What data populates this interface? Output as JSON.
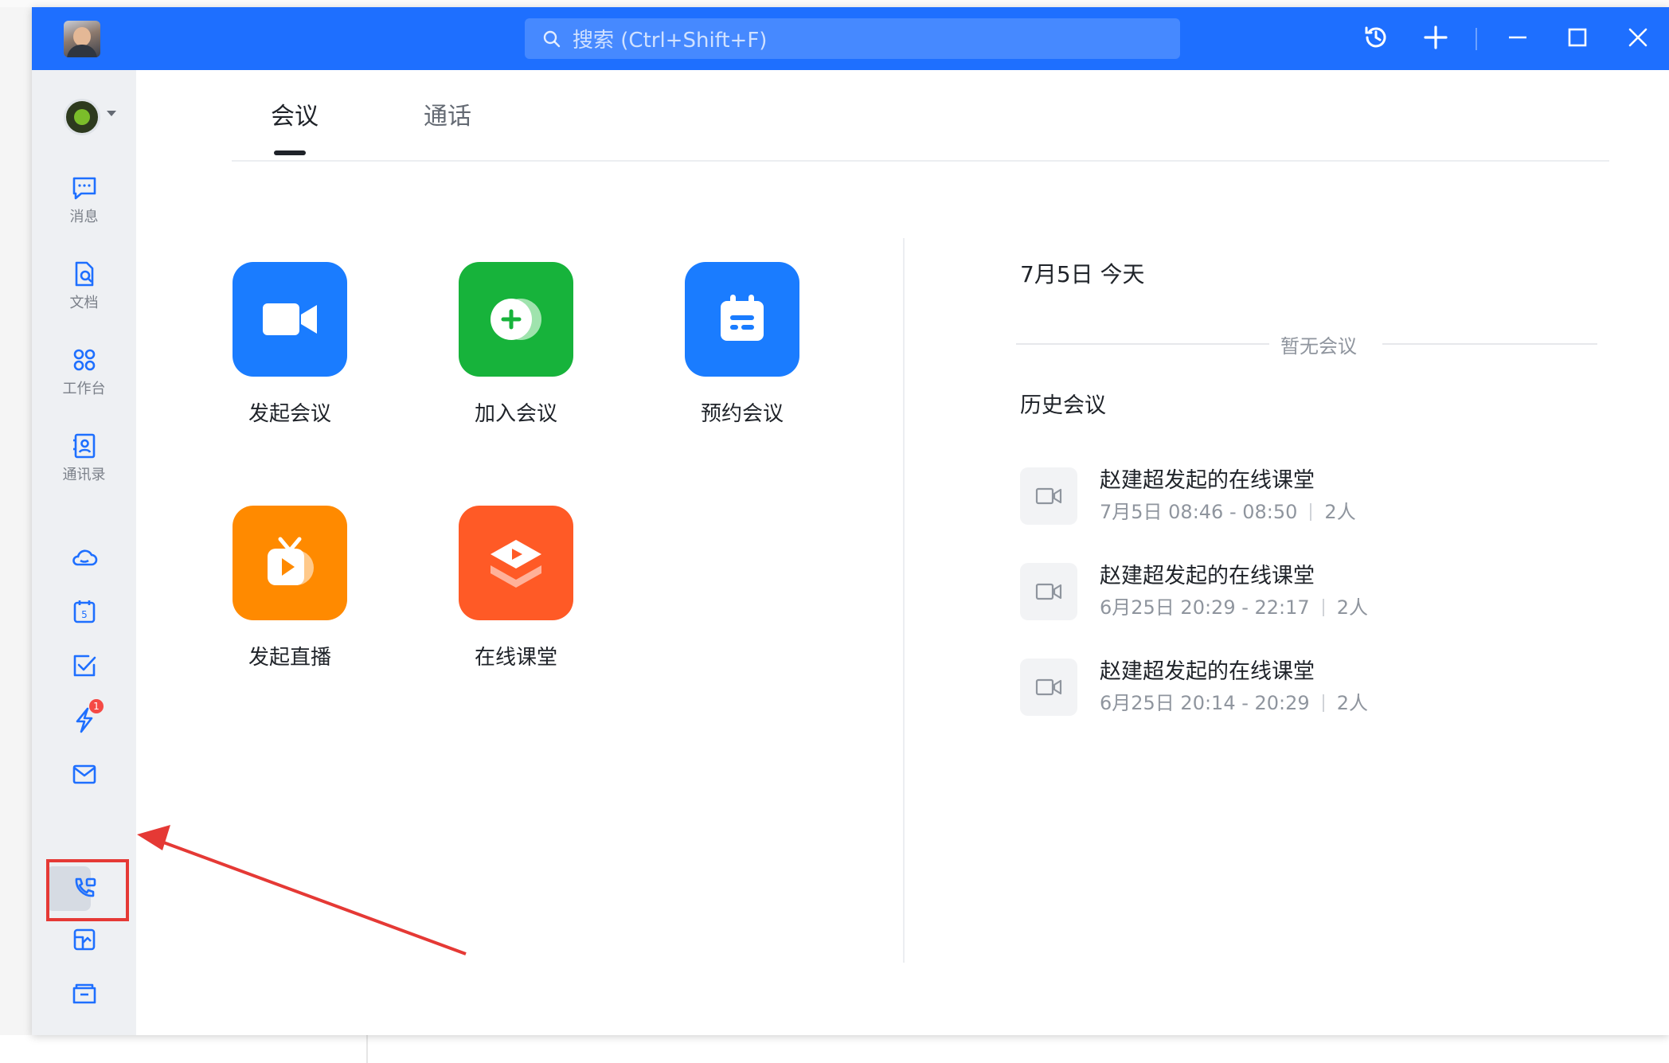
{
  "window": {
    "search_placeholder": "搜索 (Ctrl+Shift+F)",
    "icons": [
      "history-icon",
      "plus-icon",
      "minimize-icon",
      "maximize-icon",
      "close-icon"
    ],
    "accent_color": "#1e6fff"
  },
  "sidebar": {
    "items": [
      {
        "name": "messages",
        "label": "消息"
      },
      {
        "name": "docs",
        "label": "文档"
      },
      {
        "name": "workbench",
        "label": "工作台"
      },
      {
        "name": "contacts",
        "label": "通讯录"
      }
    ],
    "badge_count": "1",
    "icons_only": [
      "cloud-icon",
      "calendar-icon",
      "task-icon",
      "lightning-icon",
      "mail-icon",
      "phone-call-icon",
      "board-icon",
      "folder-icon",
      "more-icon"
    ],
    "active_item": "phone-call-icon"
  },
  "tabs": [
    {
      "label": "会议",
      "active": true
    },
    {
      "label": "通话",
      "active": false
    }
  ],
  "actions": [
    {
      "label": "发起会议",
      "color": "#1a7cff"
    },
    {
      "label": "加入会议",
      "color": "#17b33b"
    },
    {
      "label": "预约会议",
      "color": "#1a7cff"
    },
    {
      "label": "发起直播",
      "color": "#ff8a00"
    },
    {
      "label": "在线课堂",
      "color": "#ff5a26"
    }
  ],
  "schedule": {
    "date": "7月5日 今天",
    "empty_text": "暂无会议"
  },
  "history": {
    "title": "历史会议",
    "items": [
      {
        "title": "赵建超发起的在线课堂",
        "time": "7月5日 08:46 - 08:50",
        "count": "2人"
      },
      {
        "title": "赵建超发起的在线课堂",
        "time": "6月25日 20:29 - 22:17",
        "count": "2人"
      },
      {
        "title": "赵建超发起的在线课堂",
        "time": "6月25日 20:14 - 20:29",
        "count": "2人"
      }
    ]
  },
  "annotation_color": "#e53935"
}
